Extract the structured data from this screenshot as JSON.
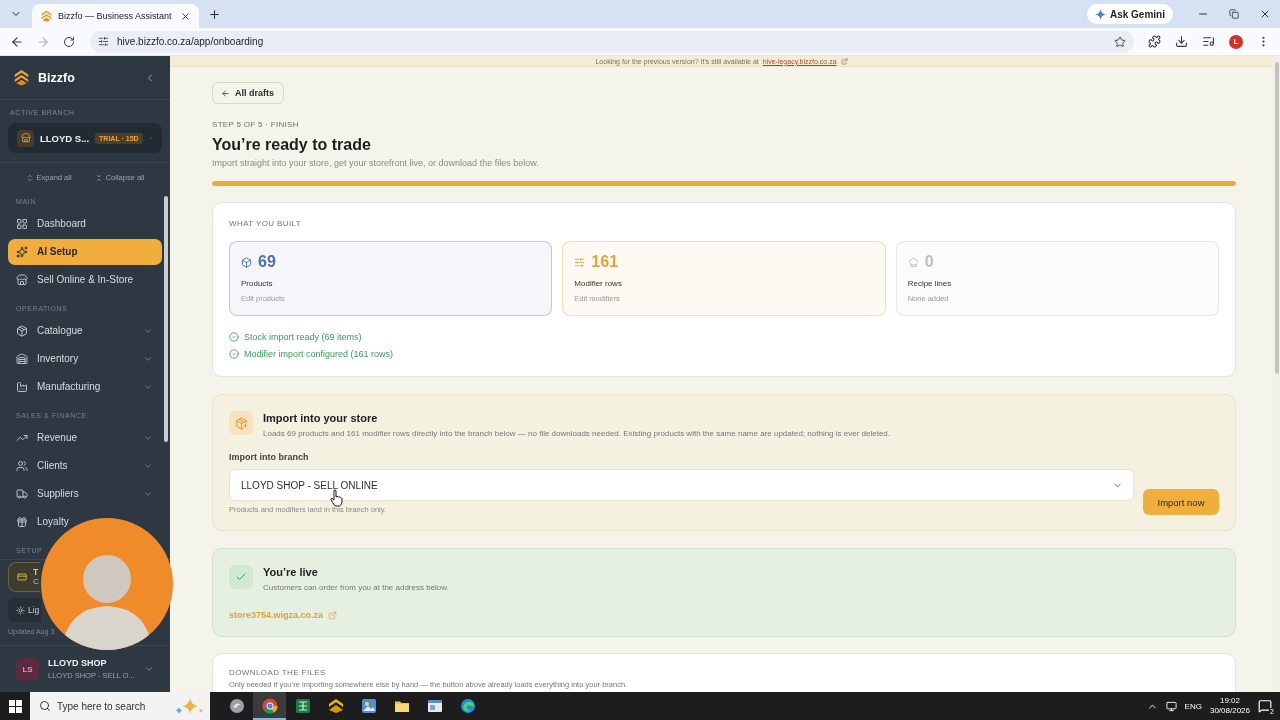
{
  "browser": {
    "tab": {
      "title": "Bizzfo — Business Assistant",
      "selected": true
    },
    "gemini_button": "Ask Gemini",
    "forward_disabled": true,
    "address": "hive.bizzfo.co.za/app/onboarding",
    "profile_initial": "L"
  },
  "sidebar": {
    "brand": "Bizzfo",
    "branch_label": "ACTIVE BRANCH",
    "branch_name": "LLOYD S...",
    "branch_badge": "TRIAL · 15D",
    "expand_all": "Expand all",
    "collapse_all": "Collapse all",
    "sections": [
      {
        "title": "MAIN",
        "items": [
          {
            "label": "Dashboard",
            "selected": false,
            "expandable": false
          },
          {
            "label": "AI Setup",
            "selected": true,
            "expandable": false
          },
          {
            "label": "Sell Online & In-Store",
            "selected": false,
            "expandable": false
          }
        ]
      },
      {
        "title": "OPERATIONS",
        "items": [
          {
            "label": "Catalogue",
            "selected": false,
            "expandable": true
          },
          {
            "label": "Inventory",
            "selected": false,
            "expandable": true
          },
          {
            "label": "Manufacturing",
            "selected": false,
            "expandable": true
          }
        ]
      },
      {
        "title": "SALES & FINANCE",
        "items": [
          {
            "label": "Revenue",
            "selected": false,
            "expandable": true
          },
          {
            "label": "Clients",
            "selected": false,
            "expandable": true
          },
          {
            "label": "Suppliers",
            "selected": false,
            "expandable": true
          },
          {
            "label": "Loyalty",
            "selected": false,
            "expandable": false
          }
        ]
      },
      {
        "title": "SETUP"
      }
    ],
    "plan_card": {
      "title": "T",
      "subtitle": "C"
    },
    "theme_button": "Lig",
    "updated": "Updated Aug 3",
    "user": {
      "initials": "LS",
      "name": "LLOYD SHOP",
      "branch": "LLOYD SHOP - SELL O..."
    }
  },
  "banner": {
    "text": "Looking for the previous version? It’s still available at",
    "link": "hive-legacy.bizzfo.co.za"
  },
  "page": {
    "back_button": "All drafts",
    "step": "STEP 5 OF 5 · FINISH",
    "title": "You’re ready to trade",
    "subtitle": "Import straight into your store, get your storefront live, or download the files below.",
    "progress": {
      "level": 1
    }
  },
  "summary": {
    "heading": "WHAT YOU BUILT",
    "stats": [
      {
        "value": "69",
        "label": "Products",
        "action": "Edit products",
        "color": "#4a6fb3"
      },
      {
        "value": "161",
        "label": "Modifier rows",
        "action": "Edit modifiers",
        "color": "#e3a43c"
      },
      {
        "value": "0",
        "label": "Recipe lines",
        "action": "None added",
        "color": "#bdbdbd"
      }
    ],
    "checks": [
      {
        "text": "Stock import ready (69 items)",
        "done": true
      },
      {
        "text": "Modifier import configured (161 rows)",
        "done": true
      }
    ]
  },
  "import_card": {
    "title": "Import into your store",
    "description": "Loads 69 products and 161 modifier rows directly into the branch below — no file downloads needed. Existing products with the same name are updated; nothing is ever deleted.",
    "field_label": "Import into branch",
    "branch_select": {
      "value": "LLOYD SHOP - SELL ONLINE"
    },
    "hint": "Products and modifiers land in this branch only.",
    "button": "Import now"
  },
  "live_card": {
    "title": "You’re live",
    "description": "Customers can order from you at the address below.",
    "link": "store3754.wigza.co.za"
  },
  "download_card": {
    "heading": "DOWNLOAD THE FILES",
    "description": "Only needed if you’re importing somewhere else by hand — the button above already loads everything into your branch."
  },
  "taskbar": {
    "search": {
      "placeholder": "Type here to search"
    },
    "apps": [
      {
        "selected": false
      },
      {
        "selected": true
      },
      {
        "selected": false
      },
      {
        "selected": false
      },
      {
        "selected": false
      },
      {
        "selected": false
      },
      {
        "selected": false
      },
      {
        "selected": false
      }
    ],
    "language": "ENG",
    "time": "19:02",
    "date": "30/08/2026",
    "notification_count": "2"
  }
}
